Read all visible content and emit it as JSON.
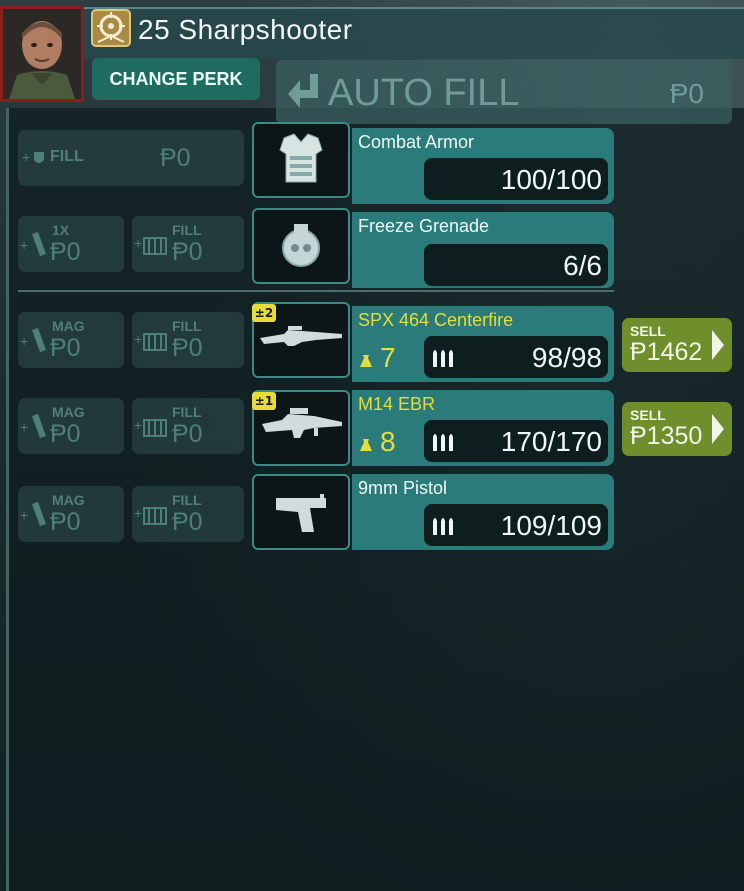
{
  "header": {
    "perk_title": "25 Sharpshooter",
    "change_perk_label": "CHANGE PERK"
  },
  "autofill": {
    "label": "AUTO FILL",
    "cost": "Ᵽ0"
  },
  "armor_row": {
    "fill_label": "FILL",
    "fill_cost": "Ᵽ0",
    "item_name": "Combat Armor",
    "count": "100/100"
  },
  "grenade_row": {
    "buy_label": "1X",
    "buy_cost": "Ᵽ0",
    "fill_label": "FILL",
    "fill_cost": "Ᵽ0",
    "item_name": "Freeze Grenade",
    "count": "6/6"
  },
  "weapons": [
    {
      "tier": "2",
      "name": "SPX 464 Centerfire",
      "weight": "7",
      "ammo": "98/98",
      "mag_label": "MAG",
      "mag_cost": "Ᵽ0",
      "fill_label": "FILL",
      "fill_cost": "Ᵽ0",
      "sell_label": "SELL",
      "sell_price": "Ᵽ1462"
    },
    {
      "tier": "1",
      "name": "M14 EBR",
      "weight": "8",
      "ammo": "170/170",
      "mag_label": "MAG",
      "mag_cost": "Ᵽ0",
      "fill_label": "FILL",
      "fill_cost": "Ᵽ0",
      "sell_label": "SELL",
      "sell_price": "Ᵽ1350"
    },
    {
      "name": "9mm Pistol",
      "ammo": "109/109",
      "mag_label": "MAG",
      "mag_cost": "Ᵽ0",
      "fill_label": "FILL",
      "fill_cost": "Ᵽ0"
    }
  ],
  "colors": {
    "accent_teal": "#2a7b7a",
    "weapon_name_yellow": "#e6dd3a",
    "sell_green": "#6e8f2b",
    "portrait_border": "#8b1d1d"
  },
  "icons": [
    "portrait-avatar",
    "sharpshooter-perk-icon",
    "autofill-arrow-icon",
    "armor-vest-icon",
    "grenade-icon",
    "rifle-icon",
    "ammo-bullets-icon",
    "weight-icon",
    "mag-icon",
    "ammo-box-icon",
    "sell-arrow-icon"
  ]
}
